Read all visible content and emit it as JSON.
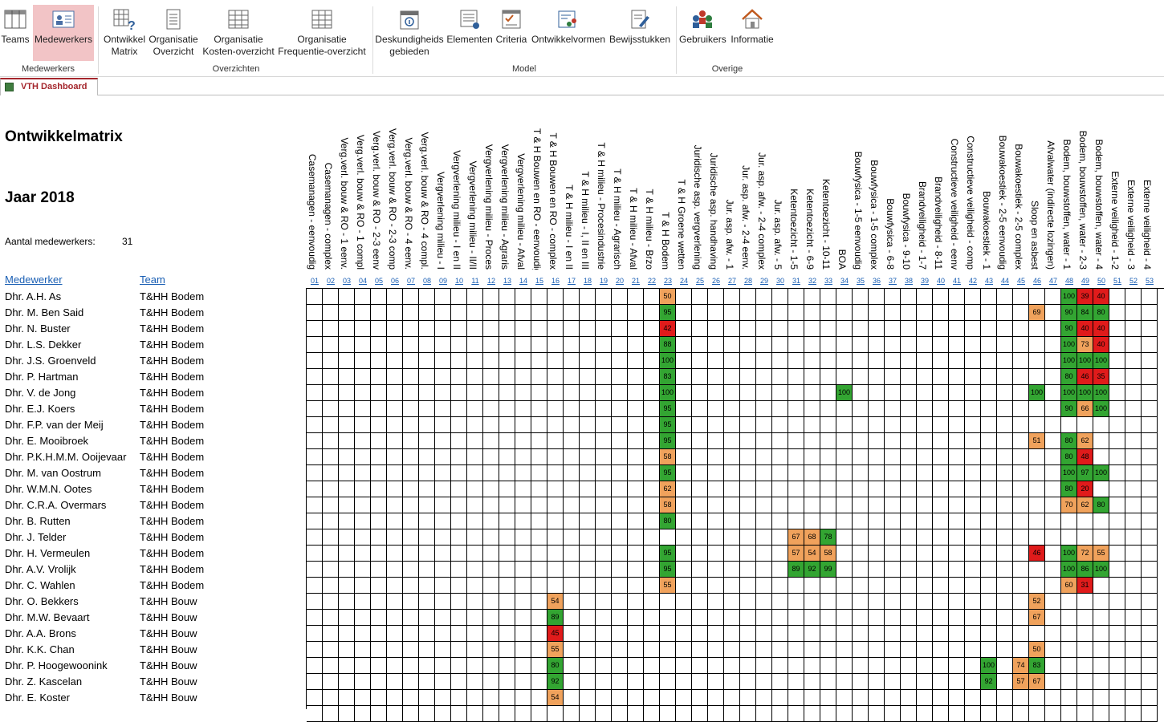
{
  "ribbon": {
    "buttons": [
      {
        "id": "teams",
        "label": "Teams",
        "icon": "table-icon"
      },
      {
        "id": "medewerkers",
        "label": "Medewerkers",
        "icon": "employee-card-icon"
      },
      {
        "id": "ontwikkel",
        "label": "Ontwikkel\nMatrix",
        "icon": "matrix-question-icon"
      },
      {
        "id": "org-overzicht",
        "label": "Organisatie\nOverzicht",
        "icon": "document-icon"
      },
      {
        "id": "org-kosten",
        "label": "Organisatie\nKosten-overzicht",
        "icon": "grid-sheet-icon"
      },
      {
        "id": "org-freq",
        "label": "Organisatie\nFrequentie-overzicht",
        "icon": "grid-sheet-icon"
      },
      {
        "id": "deskundigheid",
        "label": "Deskundigheids\ngebieden",
        "icon": "calendar-info-icon"
      },
      {
        "id": "elementen",
        "label": "Elementen",
        "icon": "list-link-icon"
      },
      {
        "id": "criteria",
        "label": "Criteria",
        "icon": "checklist-icon"
      },
      {
        "id": "ontwikkelvormen",
        "label": "Ontwikkelvormen",
        "icon": "book-people-icon"
      },
      {
        "id": "bewijsstukken",
        "label": "Bewijsstukken",
        "icon": "edit-document-icon"
      },
      {
        "id": "gebruikers",
        "label": "Gebruikers",
        "icon": "users-icon"
      },
      {
        "id": "informatie",
        "label": "Informatie",
        "icon": "home-icon"
      }
    ],
    "groups": [
      "Medewerkers",
      "Overzichten",
      "Model",
      "Overige"
    ]
  },
  "tab": {
    "label": "VTH Dashboard"
  },
  "page": {
    "title": "Ontwikkelmatrix",
    "year": "Jaar 2018",
    "count_label": "Aantal medewerkers:",
    "count_value": "31",
    "col_employee": "Medewerker",
    "col_team": "Team"
  },
  "columns": [
    {
      "n": "01",
      "label": "Casemanagen - eenvoudig"
    },
    {
      "n": "02",
      "label": "Casemanagen - complex"
    },
    {
      "n": "03",
      "label": "Verg.verl. bouw & RO - 1 eenv."
    },
    {
      "n": "04",
      "label": "Verg.verl. bouw & RO - 1 compl"
    },
    {
      "n": "05",
      "label": "Verg.verl. bouw & RO - 2-3 eenv"
    },
    {
      "n": "06",
      "label": "Verg.verl. bouw & RO - 2-3 comp"
    },
    {
      "n": "07",
      "label": "Verg.verl. bouw & RO - 4 eenv."
    },
    {
      "n": "08",
      "label": "Verg.verl. bouw & RO - 4 compl."
    },
    {
      "n": "09",
      "label": "Vergverlening milieu - I"
    },
    {
      "n": "10",
      "label": "Vergverlening milieu - I en II"
    },
    {
      "n": "11",
      "label": "Vergverlening milieu - II/II"
    },
    {
      "n": "12",
      "label": "Vergverlening milieu - Proces"
    },
    {
      "n": "13",
      "label": "Vergverlening milieu - Agraris"
    },
    {
      "n": "14",
      "label": "Vergverlening milieu - Afval"
    },
    {
      "n": "15",
      "label": "T & H Bouwen en RO - eenvoudig"
    },
    {
      "n": "16",
      "label": "T & H Bouwen en RO - complex"
    },
    {
      "n": "17",
      "label": "T & H milieu - I en II"
    },
    {
      "n": "18",
      "label": "T & H milieu - I, II en III"
    },
    {
      "n": "19",
      "label": "T & H milieu - Procesindustrie"
    },
    {
      "n": "20",
      "label": "T & H milieu - Agrarisch"
    },
    {
      "n": "21",
      "label": "T & H milieu - Afval"
    },
    {
      "n": "22",
      "label": "T & H milieu - Brzo"
    },
    {
      "n": "23",
      "label": "T & H Bodem"
    },
    {
      "n": "24",
      "label": "T & H Groene wetten"
    },
    {
      "n": "25",
      "label": "Juridische asp. vergverlening"
    },
    {
      "n": "26",
      "label": "Juridische asp. handhaving"
    },
    {
      "n": "27",
      "label": "Jur. asp. afw. - 1"
    },
    {
      "n": "28",
      "label": "Jur. asp. afw. - 2-4 eenv."
    },
    {
      "n": "29",
      "label": "Jur. asp. afw. - 2-4 complex"
    },
    {
      "n": "30",
      "label": "Jur. asp. afw. - 5"
    },
    {
      "n": "31",
      "label": "Ketentoezicht - 1-5"
    },
    {
      "n": "32",
      "label": "Ketentoezicht - 6-9"
    },
    {
      "n": "33",
      "label": "Ketentoezicht - 10-11"
    },
    {
      "n": "34",
      "label": "BOA"
    },
    {
      "n": "35",
      "label": "Bouwfysica - 1-5 eenvoudig"
    },
    {
      "n": "36",
      "label": "Bouwfysica - 1-5 complex"
    },
    {
      "n": "37",
      "label": "Bouwfysica - 6-8"
    },
    {
      "n": "38",
      "label": "Bouwfysica - 9-10"
    },
    {
      "n": "39",
      "label": "Brandveiligheid - 1-7"
    },
    {
      "n": "40",
      "label": "Brandveiligheid - 8-11"
    },
    {
      "n": "41",
      "label": "Constructieve veiligheid - eenv"
    },
    {
      "n": "42",
      "label": "Constructieve veiligheid - comp"
    },
    {
      "n": "43",
      "label": "Bouwakoestiek - 1"
    },
    {
      "n": "44",
      "label": "Bouwakoestiek - 2-5 eenvoudig"
    },
    {
      "n": "45",
      "label": "Bouwakoestiek - 2-5 complex"
    },
    {
      "n": "46",
      "label": "Sloop en asbest"
    },
    {
      "n": "47",
      "label": "Afvalwater (indirecte lozingen)"
    },
    {
      "n": "48",
      "label": "Bodem, bouwstoffen, water - 1"
    },
    {
      "n": "49",
      "label": "Bodem, bouwstoffen, water - 2-3"
    },
    {
      "n": "50",
      "label": "Bodem, bouwstoffen, water - 4"
    },
    {
      "n": "51",
      "label": "Externe veiligheid - 1-2"
    },
    {
      "n": "52",
      "label": "Externe veiligheid - 3"
    },
    {
      "n": "53",
      "label": "Externe veiligheid - 4"
    }
  ],
  "rows": [
    {
      "name": "Dhr. A.H. As",
      "team": "T&HH Bodem",
      "cells": {
        "23": [
          "50",
          "o"
        ],
        "48": [
          "100",
          "g"
        ],
        "49": [
          "39",
          "r"
        ],
        "50": [
          "40",
          "r"
        ]
      }
    },
    {
      "name": "Dhr. M. Ben Said",
      "team": "T&HH Bodem",
      "cells": {
        "23": [
          "95",
          "g"
        ],
        "46": [
          "69",
          "o"
        ],
        "48": [
          "90",
          "g"
        ],
        "49": [
          "84",
          "g"
        ],
        "50": [
          "80",
          "g"
        ]
      }
    },
    {
      "name": "Dhr. N. Buster",
      "team": "T&HH Bodem",
      "cells": {
        "23": [
          "42",
          "r"
        ],
        "48": [
          "90",
          "g"
        ],
        "49": [
          "40",
          "r"
        ],
        "50": [
          "40",
          "r"
        ]
      }
    },
    {
      "name": "Dhr. L.S. Dekker",
      "team": "T&HH Bodem",
      "cells": {
        "23": [
          "88",
          "g"
        ],
        "48": [
          "100",
          "g"
        ],
        "49": [
          "73",
          "o"
        ],
        "50": [
          "40",
          "r"
        ]
      }
    },
    {
      "name": "Dhr. J.S. Groenveld",
      "team": "T&HH Bodem",
      "cells": {
        "23": [
          "100",
          "g"
        ],
        "48": [
          "100",
          "g"
        ],
        "49": [
          "100",
          "g"
        ],
        "50": [
          "100",
          "g"
        ]
      }
    },
    {
      "name": "Dhr. P. Hartman",
      "team": "T&HH Bodem",
      "cells": {
        "23": [
          "83",
          "g"
        ],
        "48": [
          "80",
          "g"
        ],
        "49": [
          "46",
          "r"
        ],
        "50": [
          "35",
          "r"
        ]
      }
    },
    {
      "name": "Dhr. V. de Jong",
      "team": "T&HH Bodem",
      "cells": {
        "23": [
          "100",
          "g"
        ],
        "34": [
          "100",
          "g"
        ],
        "46": [
          "100",
          "g"
        ],
        "48": [
          "100",
          "g"
        ],
        "49": [
          "100",
          "g"
        ],
        "50": [
          "100",
          "g"
        ]
      }
    },
    {
      "name": "Dhr. E.J. Koers",
      "team": "T&HH Bodem",
      "cells": {
        "23": [
          "95",
          "g"
        ],
        "48": [
          "90",
          "g"
        ],
        "49": [
          "66",
          "o"
        ],
        "50": [
          "100",
          "g"
        ]
      }
    },
    {
      "name": "Dhr. F.P. van der Meij",
      "team": "T&HH Bodem",
      "cells": {
        "23": [
          "95",
          "g"
        ]
      }
    },
    {
      "name": "Dhr. E. Mooibroek",
      "team": "T&HH Bodem",
      "cells": {
        "23": [
          "95",
          "g"
        ],
        "46": [
          "51",
          "o"
        ],
        "48": [
          "80",
          "g"
        ],
        "49": [
          "62",
          "o"
        ]
      }
    },
    {
      "name": "Dhr. P.K.H.M.M. Ooijevaar",
      "team": "T&HH Bodem",
      "cells": {
        "23": [
          "58",
          "o"
        ],
        "48": [
          "80",
          "g"
        ],
        "49": [
          "48",
          "r"
        ]
      }
    },
    {
      "name": "Dhr. M. van Oostrum",
      "team": "T&HH Bodem",
      "cells": {
        "23": [
          "95",
          "g"
        ],
        "48": [
          "100",
          "g"
        ],
        "49": [
          "97",
          "g"
        ],
        "50": [
          "100",
          "g"
        ]
      }
    },
    {
      "name": "Dhr. W.M.N. Ootes",
      "team": "T&HH Bodem",
      "cells": {
        "23": [
          "62",
          "o"
        ],
        "48": [
          "80",
          "g"
        ],
        "49": [
          "20",
          "r"
        ]
      }
    },
    {
      "name": "Dhr. C.R.A. Overmars",
      "team": "T&HH Bodem",
      "cells": {
        "23": [
          "58",
          "o"
        ],
        "48": [
          "70",
          "o"
        ],
        "49": [
          "62",
          "o"
        ],
        "50": [
          "80",
          "g"
        ]
      }
    },
    {
      "name": "Dhr. B. Rutten",
      "team": "T&HH Bodem",
      "cells": {
        "23": [
          "80",
          "g"
        ]
      }
    },
    {
      "name": "Dhr. J. Telder",
      "team": "T&HH Bodem",
      "cells": {
        "31": [
          "67",
          "o"
        ],
        "32": [
          "68",
          "o"
        ],
        "33": [
          "78",
          "g"
        ]
      }
    },
    {
      "name": "Dhr. H. Vermeulen",
      "team": "T&HH Bodem",
      "cells": {
        "23": [
          "95",
          "g"
        ],
        "31": [
          "57",
          "o"
        ],
        "32": [
          "54",
          "o"
        ],
        "33": [
          "58",
          "o"
        ],
        "46": [
          "46",
          "r"
        ],
        "48": [
          "100",
          "g"
        ],
        "49": [
          "72",
          "o"
        ],
        "50": [
          "55",
          "o"
        ]
      }
    },
    {
      "name": "Dhr. A.V. Vrolijk",
      "team": "T&HH Bodem",
      "cells": {
        "23": [
          "95",
          "g"
        ],
        "31": [
          "89",
          "g"
        ],
        "32": [
          "92",
          "g"
        ],
        "33": [
          "99",
          "g"
        ],
        "48": [
          "100",
          "g"
        ],
        "49": [
          "86",
          "g"
        ],
        "50": [
          "100",
          "g"
        ]
      }
    },
    {
      "name": "Dhr. C. Wahlen",
      "team": "T&HH Bodem",
      "cells": {
        "23": [
          "55",
          "o"
        ],
        "48": [
          "60",
          "o"
        ],
        "49": [
          "31",
          "r"
        ]
      }
    },
    {
      "name": "Dhr. O. Bekkers",
      "team": "T&HH Bouw",
      "cells": {
        "16": [
          "54",
          "o"
        ],
        "46": [
          "52",
          "o"
        ]
      }
    },
    {
      "name": "Dhr. M.W. Bevaart",
      "team": "T&HH Bouw",
      "cells": {
        "16": [
          "89",
          "g"
        ],
        "46": [
          "67",
          "o"
        ]
      }
    },
    {
      "name": "Dhr. A.A. Brons",
      "team": "T&HH Bouw",
      "cells": {
        "16": [
          "45",
          "r"
        ]
      }
    },
    {
      "name": "Dhr. K.K. Chan",
      "team": "T&HH Bouw",
      "cells": {
        "16": [
          "55",
          "o"
        ],
        "46": [
          "50",
          "o"
        ]
      }
    },
    {
      "name": "Dhr. P. Hoogewoonink",
      "team": "T&HH Bouw",
      "cells": {
        "16": [
          "80",
          "g"
        ],
        "43": [
          "100",
          "g"
        ],
        "45": [
          "74",
          "o"
        ],
        "46": [
          "83",
          "g"
        ]
      }
    },
    {
      "name": "Dhr. Z. Kascelan",
      "team": "T&HH Bouw",
      "cells": {
        "16": [
          "92",
          "g"
        ],
        "43": [
          "92",
          "g"
        ],
        "45": [
          "57",
          "o"
        ],
        "46": [
          "67",
          "o"
        ]
      }
    },
    {
      "name": "Dhr. E. Koster",
      "team": "T&HH Bouw",
      "cells": {
        "16": [
          "54",
          "o"
        ]
      }
    }
  ]
}
